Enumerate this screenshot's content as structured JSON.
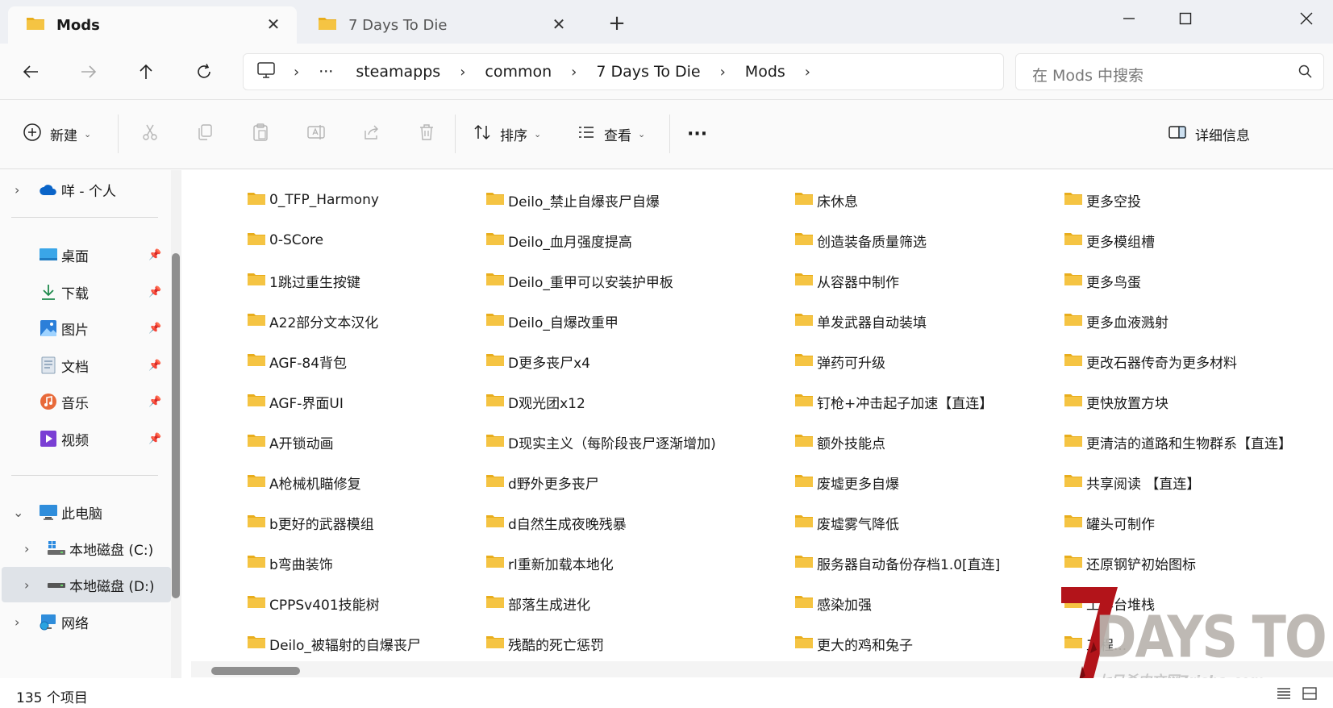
{
  "tabs": [
    {
      "label": "Mods",
      "active": true
    },
    {
      "label": "7 Days To Die",
      "active": false
    }
  ],
  "address": {
    "overflow_label": "···",
    "crumbs": [
      "steamapps",
      "common",
      "7 Days To Die",
      "Mods"
    ]
  },
  "search": {
    "placeholder": "在 Mods 中搜索"
  },
  "commands": {
    "new_label": "新建",
    "sort_label": "排序",
    "view_label": "查看",
    "more_label": "···",
    "details_label": "详细信息"
  },
  "sidebar": {
    "cloud_label": "咩 - 个人",
    "quick": [
      {
        "label": "桌面",
        "icon": "desktop-icon"
      },
      {
        "label": "下载",
        "icon": "download-icon"
      },
      {
        "label": "图片",
        "icon": "pictures-icon"
      },
      {
        "label": "文档",
        "icon": "documents-icon"
      },
      {
        "label": "音乐",
        "icon": "music-icon"
      },
      {
        "label": "视频",
        "icon": "videos-icon"
      }
    ],
    "this_pc_label": "此电脑",
    "drives": [
      {
        "label": "本地磁盘 (C:)",
        "selected": false
      },
      {
        "label": "本地磁盘 (D:)",
        "selected": true
      }
    ],
    "network_label": "网络"
  },
  "folders": {
    "col1": [
      "0_TFP_Harmony",
      "0-SCore",
      "1跳过重生按键",
      "A22部分文本汉化",
      "AGF-84背包",
      "AGF-界面UI",
      "A开锁动画",
      "A枪械机瞄修复",
      "b更好的武器模组",
      "b弯曲装饰",
      "CPPSv401技能树",
      "Deilo_被辐射的自爆丧尸"
    ],
    "col2": [
      "Deilo_禁止自爆丧尸自爆",
      "Deilo_血月强度提高",
      "Deilo_重甲可以安装护甲板",
      "Deilo_自爆改重甲",
      "D更多丧尸x4",
      "D观光团x12",
      "D现实主义（每阶段丧尸逐渐增加)",
      "d野外更多丧尸",
      "d自然生成夜晚残暴",
      "rl重新加载本地化",
      "部落生成进化",
      "残酷的死亡惩罚"
    ],
    "col3": [
      "床休息",
      "创造装备质量筛选",
      "从容器中制作",
      "单发武器自动装填",
      "弹药可升级",
      "钉枪+冲击起子加速【直连】",
      "额外技能点",
      "废墟更多自爆",
      "废墟雾气降低",
      "服务器自动备份存档1.0[直连]",
      "感染加强",
      "更大的鸡和兔子"
    ],
    "col4": [
      "更多空投",
      "更多模组槽",
      "更多鸟蛋",
      "更多血液溅射",
      "更改石器传奇为更多材料",
      "更快放置方块",
      "更清洁的道路和生物群系【直连】",
      "共享阅读 【直连】",
      "罐头可制作",
      "还原钢铲初始图标",
      "工作台堆栈",
      "工程..."
    ]
  },
  "status": {
    "count_text": "135 个项目"
  },
  "watermark": {
    "title": "DAYS TO DIE",
    "subtitle": "七日杀中文网7risha.com"
  },
  "colors": {
    "folder": "#f5c443",
    "folder_dark": "#e8ad1c",
    "accent": "#0067c0"
  }
}
